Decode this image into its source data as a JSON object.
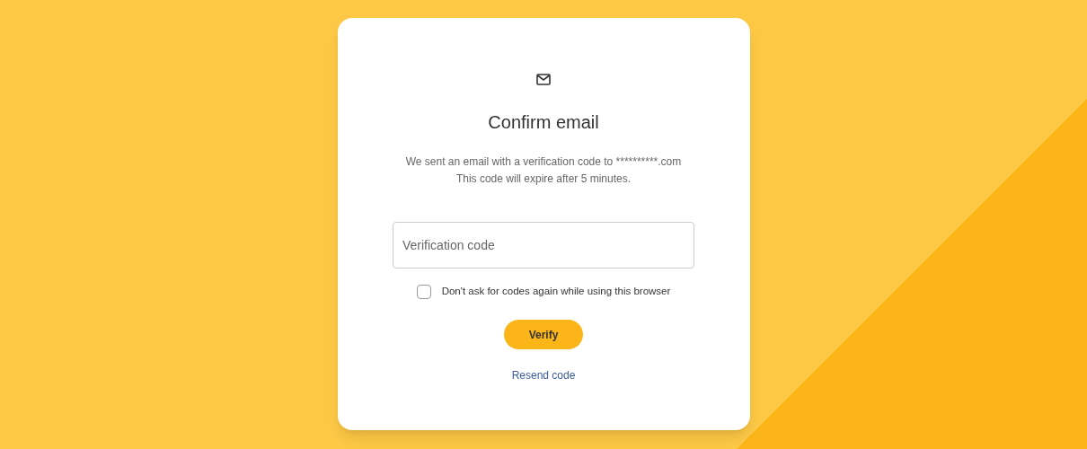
{
  "title": "Confirm email",
  "description_lines": [
    "We sent an email with a verification code to **********.com",
    "This code will expire after 5 minutes."
  ],
  "code_field": {
    "placeholder": "Verification code"
  },
  "remember_checkbox": {
    "label": "Don't ask for codes again while using this browser",
    "checked": false
  },
  "verify_button": {
    "label": "Verify"
  },
  "resend_link": {
    "label": "Resend code"
  }
}
